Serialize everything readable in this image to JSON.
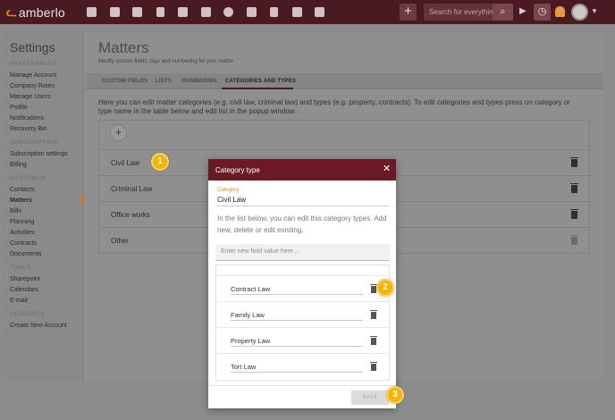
{
  "app": {
    "logo_text": "amberlo",
    "search_placeholder": "Search for everything..."
  },
  "topbar_icons": [
    "dashboard-icon",
    "contacts-icon",
    "briefcase-icon",
    "document-icon",
    "bank-icon",
    "calendar-icon",
    "chat-icon",
    "folder-icon",
    "invoice-icon",
    "mail-icon",
    "report-icon"
  ],
  "sidebar": {
    "title": "Settings",
    "groups": [
      {
        "label": "PREFERENCES",
        "items": [
          "Manage Account",
          "Company Rates",
          "Manage Users",
          "Profile",
          "Notifications",
          "Recovery Bin"
        ]
      },
      {
        "label": "SUBSCRIPTION",
        "items": [
          "Subscription settings",
          "Billing"
        ]
      },
      {
        "label": "CUSTOMIZE",
        "items": [
          "Contacts",
          "Matters",
          "Bills",
          "Planning",
          "Activities",
          "Contracts",
          "Documents"
        ]
      },
      {
        "label": "TOOLS",
        "items": [
          "Sharepoint",
          "Calendars",
          "E-mail"
        ]
      },
      {
        "label": "ACCOUNTS",
        "items": [
          "Create New Account"
        ]
      }
    ],
    "active_item": "Matters"
  },
  "content": {
    "title": "Matters",
    "subtitle": "Modify custom fields, tags and numbering for your matter",
    "tabs": [
      "CUSTOM FIELDS",
      "LISTS",
      "NUMBERING",
      "CATEGORIES AND TYPES"
    ],
    "active_tab": "CATEGORIES AND TYPES",
    "intro": "Here you can edit matter categories (e.g. civil law, criminal law) and types (e.g. property, contracts). To edit categories and types press on category or type name in the table below and edit list in the popup window.",
    "add_symbol": "+",
    "categories": [
      "Civil Law",
      "Criminal Law",
      "Office works",
      "Other"
    ]
  },
  "modal": {
    "title": "Category type",
    "close_symbol": "✕",
    "field_label": "Category",
    "field_value": "Civil Law",
    "help_text": "In the list below, you can edit this category types. Add new, delete or edit existing.",
    "new_value_placeholder": "Enter new field value here...",
    "types": [
      "Contract Law",
      "Family Law",
      "Property Law",
      "Tort Law"
    ],
    "save_label": "SAVE"
  },
  "callouts": [
    "1",
    "2",
    "3"
  ],
  "colors": {
    "topbar": "#4a1a22",
    "modal_header": "#6a1a25",
    "accent_orange": "#e08a2e",
    "badge_yellow": "#f4b400"
  }
}
